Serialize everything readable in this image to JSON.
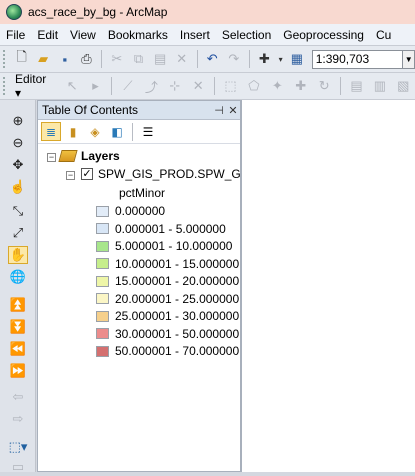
{
  "window": {
    "title": "acs_race_by_bg - ArcMap"
  },
  "menu": [
    "File",
    "Edit",
    "View",
    "Bookmarks",
    "Insert",
    "Selection",
    "Geoprocessing",
    "Cu"
  ],
  "toolbar": {
    "scale_value": "1:390,703",
    "editor_label": "Editor"
  },
  "toc": {
    "title": "Table Of Contents",
    "layers_label": "Layers",
    "layer_name": "SPW_GIS_PROD.SPW_GDB",
    "field_name": "pctMinor",
    "legend": [
      {
        "label": "0.000000",
        "color": "#e2ecf8"
      },
      {
        "label": "0.000001 - 5.000000",
        "color": "#d8e6f6"
      },
      {
        "label": "5.000001 - 10.000000",
        "color": "#a8e68c"
      },
      {
        "label": "10.000001 - 15.000000",
        "color": "#c6ee8c"
      },
      {
        "label": "15.000001 - 20.000000",
        "color": "#eef6a8"
      },
      {
        "label": "20.000001 - 25.000000",
        "color": "#fbf6c6"
      },
      {
        "label": "25.000001 - 30.000000",
        "color": "#f6d08c"
      },
      {
        "label": "30.000001 - 50.000000",
        "color": "#ec8c8c"
      },
      {
        "label": "50.000001 - 70.000000",
        "color": "#d47070"
      }
    ]
  }
}
